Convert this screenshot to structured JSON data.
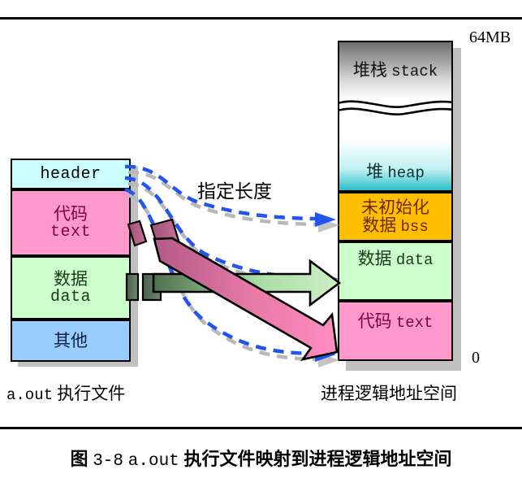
{
  "figure": {
    "caption_prefix": "图",
    "caption_number": "3-8",
    "caption_file": "a.out",
    "caption_text": "执行文件映射到进程逻辑地址空间",
    "caption_full": "图 3-8 a.out 执行文件映射到进程逻辑地址空间"
  },
  "left_block": {
    "label_file": "a.out",
    "label_text": "执行文件",
    "segments": [
      {
        "name": "header",
        "en": "header",
        "cn": "",
        "color": "#ccffff"
      },
      {
        "name": "text",
        "cn": "代码",
        "en": "text",
        "color": "#ff99cc"
      },
      {
        "name": "data",
        "cn": "数据",
        "en": "data",
        "color": "#ccffcc"
      },
      {
        "name": "other",
        "cn": "其他",
        "en": "",
        "color": "#99ccff"
      }
    ]
  },
  "right_block": {
    "label": "进程逻辑地址空间",
    "scale_top": "64MB",
    "scale_bottom": "0",
    "segments": [
      {
        "name": "stack",
        "cn": "堆栈",
        "en": "stack",
        "color": "#7a7a7a"
      },
      {
        "name": "heap",
        "cn": "堆",
        "en": "heap",
        "color": "#2bbfc8"
      },
      {
        "name": "bss",
        "cn_line1": "未初始化",
        "cn_line2": "数据",
        "en": "bss",
        "color": "#ffbf00"
      },
      {
        "name": "data",
        "cn": "数据",
        "en": "data",
        "color": "#ccffcc"
      },
      {
        "name": "text",
        "cn": "代码",
        "en": "text",
        "color": "#ff99cc"
      }
    ]
  },
  "annotations": {
    "length_label": "指定长度"
  },
  "colors": {
    "header": "#ccffff",
    "text_section": "#ff99cc",
    "data_section": "#ccffcc",
    "other_section": "#99ccff",
    "bss_section": "#ffbf00",
    "heap_section": "#2bbfc8",
    "stack_section": "#7a7a7a",
    "dashed_blue": "#2255ee",
    "dashed_gray": "#b3b3b3",
    "arrow_pink": "#ff79b4",
    "arrow_green": "#b8e8b0",
    "shadow": "#c0c0c0"
  }
}
